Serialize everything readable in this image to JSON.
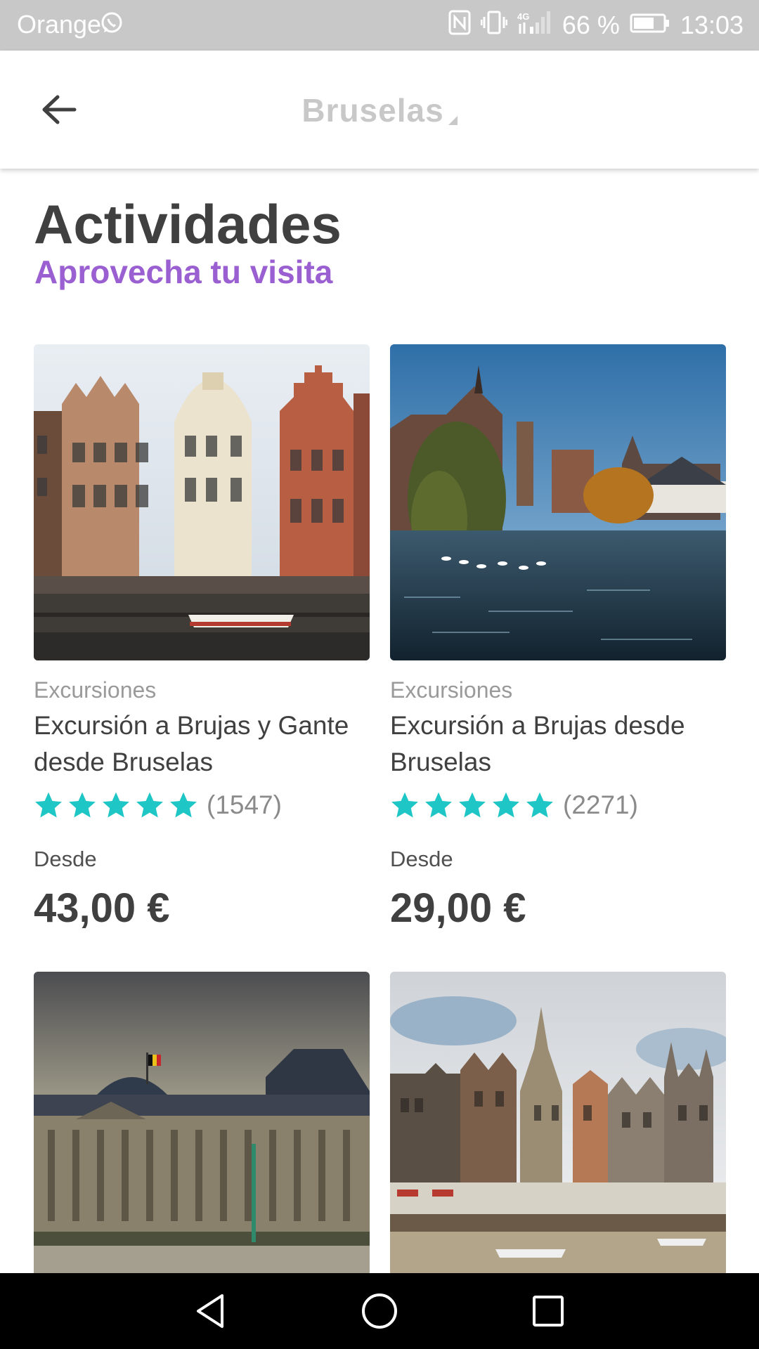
{
  "status_bar": {
    "carrier": "Orange",
    "battery": "66 %",
    "time": "13:03",
    "icons": [
      "whatsapp-icon",
      "nfc-icon",
      "vibrate-icon",
      "4g-signal-icon",
      "battery-icon"
    ]
  },
  "header": {
    "city": "Bruselas",
    "back_icon": "arrow-left-icon"
  },
  "section": {
    "title": "Actividades",
    "subtitle": "Aprovecha tu visita"
  },
  "cards": [
    {
      "category": "Excursiones",
      "title": "Excursión a Brujas y Gante desde Bruselas",
      "rating": 5,
      "reviews": "(1547)",
      "from_label": "Desde",
      "price": "43,00 €",
      "image": "ghent-guild-houses-photo"
    },
    {
      "category": "Excursiones",
      "title": "Excursión a Brujas desde Bruselas",
      "rating": 5,
      "reviews": "(2271)",
      "from_label": "Desde",
      "price": "29,00 €",
      "image": "bruges-canal-swans-photo"
    },
    {
      "image": "royal-palace-brussels-photo"
    },
    {
      "image": "ghent-graslei-quay-photo"
    }
  ],
  "colors": {
    "status_bar": "#c8c8c8",
    "accent_purple": "#9a5fd0",
    "star_teal": "#1fc6c6",
    "text_dark": "#404040",
    "text_muted": "#9a9a9a"
  },
  "nav_bar": {
    "icons": [
      "back-triangle-icon",
      "home-circle-icon",
      "recents-square-icon"
    ]
  }
}
